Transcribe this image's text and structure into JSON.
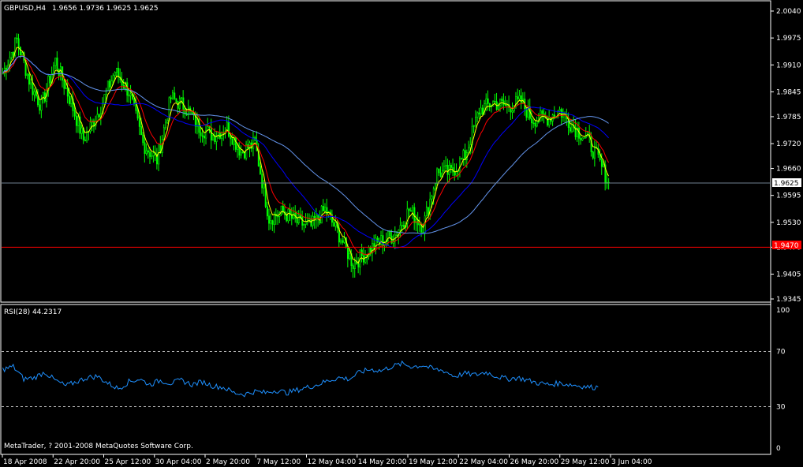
{
  "colors": {
    "background": "#000000",
    "frame": "#ffffff",
    "candles": "#00ff00",
    "ma_fast": "#ffff00",
    "ma_mid": "#ff0000",
    "ma_slow": "#0000ff",
    "ma_slowest": "#6495ed",
    "rsi": "#1e90ff",
    "bid_line": "#708090",
    "level_line": "#ff0000"
  },
  "chart_data": [
    {
      "type": "candlestick",
      "title": "GBPUSD,H4",
      "ohlc_text": "1.9656 1.9736 1.9625 1.9625",
      "ylim": [
        1.9345,
        2.004
      ],
      "y_ticks": [
        "2.0040",
        "1.9975",
        "1.9910",
        "1.9845",
        "1.9785",
        "1.9720",
        "1.9660",
        "1.9595",
        "1.9530",
        "1.9470",
        "1.9405",
        "1.9345"
      ],
      "x_ticks": [
        "18 Apr 2008",
        "22 Apr 20:00",
        "25 Apr 12:00",
        "30 Apr 04:00",
        "2 May 20:00",
        "7 May 12:00",
        "12 May 04:00",
        "14 May 20:00",
        "19 May 12:00",
        "22 May 04:00",
        "26 May 20:00",
        "29 May 12:00",
        "3 Jun 04:00"
      ],
      "current_price": "1.9625",
      "level_price": "1.9470",
      "indicators": [
        "moving averages (4)"
      ],
      "close_anchors": [
        [
          0,
          1.989
        ],
        [
          8,
          1.997
        ],
        [
          16,
          1.986
        ],
        [
          22,
          1.981
        ],
        [
          30,
          1.992
        ],
        [
          38,
          1.983
        ],
        [
          46,
          1.973
        ],
        [
          55,
          1.98
        ],
        [
          64,
          1.9895
        ],
        [
          72,
          1.9845
        ],
        [
          80,
          1.972
        ],
        [
          88,
          1.968
        ],
        [
          96,
          1.983
        ],
        [
          104,
          1.981
        ],
        [
          112,
          1.976
        ],
        [
          120,
          1.974
        ],
        [
          128,
          1.976
        ],
        [
          136,
          1.97
        ],
        [
          144,
          1.972
        ],
        [
          152,
          1.954
        ],
        [
          160,
          1.9555
        ],
        [
          168,
          1.953
        ],
        [
          176,
          1.952
        ],
        [
          184,
          1.956
        ],
        [
          192,
          1.95
        ],
        [
          200,
          1.943
        ],
        [
          208,
          1.946
        ],
        [
          216,
          1.9485
        ],
        [
          224,
          1.95
        ],
        [
          232,
          1.956
        ],
        [
          240,
          1.952
        ],
        [
          248,
          1.965
        ],
        [
          256,
          1.965
        ],
        [
          264,
          1.969
        ],
        [
          272,
          1.98
        ],
        [
          280,
          1.982
        ],
        [
          288,
          1.981
        ],
        [
          296,
          1.982
        ],
        [
          302,
          1.978
        ],
        [
          310,
          1.978
        ],
        [
          318,
          1.98
        ],
        [
          326,
          1.976
        ],
        [
          334,
          1.973
        ],
        [
          340,
          1.968
        ],
        [
          346,
          1.9625
        ]
      ]
    },
    {
      "type": "line",
      "title": "RSI(28) 44.2317",
      "ylim": [
        0,
        100
      ],
      "y_ticks": [
        "100",
        "70",
        "30",
        "0"
      ],
      "levels": [
        70,
        30
      ],
      "rsi_anchors": [
        [
          0,
          57
        ],
        [
          6,
          59
        ],
        [
          12,
          50
        ],
        [
          18,
          51
        ],
        [
          24,
          55
        ],
        [
          30,
          49
        ],
        [
          36,
          45
        ],
        [
          42,
          48
        ],
        [
          48,
          51
        ],
        [
          54,
          52
        ],
        [
          60,
          47
        ],
        [
          66,
          43
        ],
        [
          72,
          48
        ],
        [
          78,
          50
        ],
        [
          84,
          46
        ],
        [
          90,
          49
        ],
        [
          96,
          47
        ],
        [
          102,
          49
        ],
        [
          108,
          46
        ],
        [
          114,
          48
        ],
        [
          120,
          45
        ],
        [
          126,
          44
        ],
        [
          132,
          40
        ],
        [
          138,
          39
        ],
        [
          144,
          41
        ],
        [
          150,
          40
        ],
        [
          156,
          42
        ],
        [
          162,
          40
        ],
        [
          168,
          42
        ],
        [
          174,
          44
        ],
        [
          180,
          46
        ],
        [
          186,
          49
        ],
        [
          192,
          51
        ],
        [
          198,
          50
        ],
        [
          204,
          55
        ],
        [
          210,
          57
        ],
        [
          216,
          56
        ],
        [
          222,
          59
        ],
        [
          228,
          61
        ],
        [
          234,
          59
        ],
        [
          240,
          60
        ],
        [
          246,
          57
        ],
        [
          252,
          56
        ],
        [
          258,
          52
        ],
        [
          264,
          54
        ],
        [
          270,
          53
        ],
        [
          276,
          55
        ],
        [
          282,
          52
        ],
        [
          288,
          50
        ],
        [
          294,
          51
        ],
        [
          300,
          49
        ],
        [
          306,
          47
        ],
        [
          312,
          46
        ],
        [
          318,
          47
        ],
        [
          324,
          46
        ],
        [
          330,
          45
        ],
        [
          336,
          44
        ],
        [
          340,
          44.2317
        ]
      ]
    }
  ],
  "footer": {
    "copyright": "MetaTrader, ? 2001-2008 MetaQuotes Software Corp."
  }
}
